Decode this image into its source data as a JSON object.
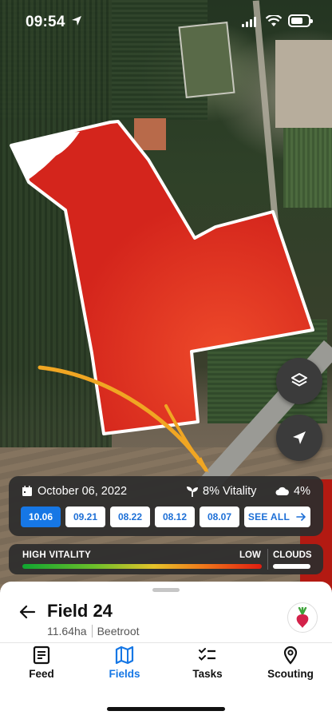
{
  "status_bar": {
    "time": "09:54"
  },
  "date_panel": {
    "date": "October 06, 2022",
    "vitality": "8% Vitality",
    "cloud": "4%",
    "dates": [
      "10.06",
      "09.21",
      "08.22",
      "08.12",
      "08.07"
    ],
    "active_date": "10.06",
    "see_all": "SEE ALL"
  },
  "legend": {
    "high": "HIGH VITALITY",
    "low": "LOW",
    "clouds": "CLOUDS"
  },
  "field": {
    "name": "Field 24",
    "area": "11.64ha",
    "crop": "Beetroot"
  },
  "tabs": [
    {
      "label": "Feed",
      "icon": "document-icon",
      "active": false
    },
    {
      "label": "Fields",
      "icon": "map-icon",
      "active": true
    },
    {
      "label": "Tasks",
      "icon": "checklist-icon",
      "active": false
    },
    {
      "label": "Scouting",
      "icon": "map-pin-icon",
      "active": false
    }
  ],
  "colors": {
    "accent": "#1677e5",
    "field_overlay": "#d4251c",
    "arrow": "#f0a623"
  }
}
